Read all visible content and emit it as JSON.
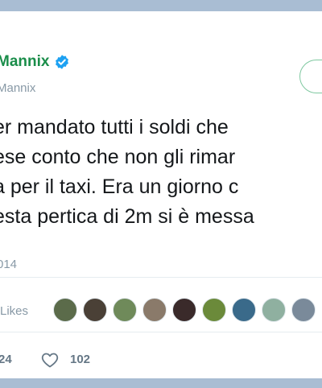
{
  "user": {
    "display_name": "Mannix",
    "handle": "Mannix"
  },
  "tweet": {
    "lines": [
      "er mandato tutti i soldi che",
      "ese conto che non gli rimar",
      "a per il taxi. Era un giorno c",
      "esta pertica di 2m si è messa"
    ],
    "timestamp": "014"
  },
  "engagement": {
    "likes_label": "Likes",
    "avatar_colors": [
      "#5b6b4a",
      "#4a4036",
      "#6f8a5a",
      "#8a7a6a",
      "#3a2a2a",
      "#6b8a3a",
      "#3a6a8a",
      "#8fb0a0",
      "#7a8a9a"
    ]
  },
  "actions": {
    "reply_count": "24",
    "like_count": "102"
  },
  "colors": {
    "accent": "#1a8d4a",
    "verified": "#1da1f2",
    "muted": "#8899a6"
  }
}
